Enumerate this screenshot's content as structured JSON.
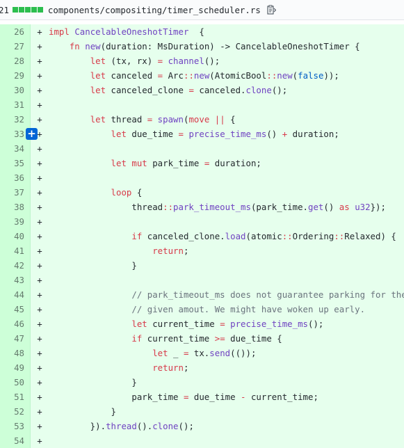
{
  "file": {
    "changes_count": "21",
    "path": "components/compositing/timer_scheduler.rs",
    "copy_icon": "clipboard-icon",
    "diffstat_color": "#2cbe4e"
  },
  "lines": [
    {
      "num": "26",
      "marker": "+",
      "code": [
        [
          "k",
          "impl "
        ],
        [
          "t",
          "CancelableOneshotTimer"
        ],
        [
          "",
          "  {"
        ]
      ]
    },
    {
      "num": "27",
      "marker": "+",
      "code": [
        [
          "",
          "    "
        ],
        [
          "k",
          "fn "
        ],
        [
          "f",
          "new"
        ],
        [
          "",
          "(duration: MsDuration) -> CancelableOneshotTimer {"
        ]
      ]
    },
    {
      "num": "28",
      "marker": "+",
      "code": [
        [
          "",
          "        "
        ],
        [
          "k",
          "let "
        ],
        [
          "",
          "(tx, rx) "
        ],
        [
          "k",
          "= "
        ],
        [
          "f",
          "channel"
        ],
        [
          "",
          "();"
        ]
      ]
    },
    {
      "num": "29",
      "marker": "+",
      "code": [
        [
          "",
          "        "
        ],
        [
          "k",
          "let "
        ],
        [
          "",
          "canceled "
        ],
        [
          "k",
          "= "
        ],
        [
          "",
          "Arc"
        ],
        [
          "k",
          "::"
        ],
        [
          "f",
          "new"
        ],
        [
          "",
          "(AtomicBool"
        ],
        [
          "k",
          "::"
        ],
        [
          "f",
          "new"
        ],
        [
          "",
          "("
        ],
        [
          "o",
          "false"
        ],
        [
          "",
          "));"
        ]
      ]
    },
    {
      "num": "30",
      "marker": "+",
      "code": [
        [
          "",
          "        "
        ],
        [
          "k",
          "let "
        ],
        [
          "",
          "canceled_clone "
        ],
        [
          "k",
          "= "
        ],
        [
          "",
          "canceled."
        ],
        [
          "f",
          "clone"
        ],
        [
          "",
          "();"
        ]
      ]
    },
    {
      "num": "31",
      "marker": "+",
      "code": []
    },
    {
      "num": "32",
      "marker": "+",
      "code": [
        [
          "",
          "        "
        ],
        [
          "k",
          "let "
        ],
        [
          "",
          "thread "
        ],
        [
          "k",
          "= "
        ],
        [
          "f",
          "spawn"
        ],
        [
          "",
          "("
        ],
        [
          "k",
          "move "
        ],
        [
          "k",
          "|| "
        ],
        [
          "",
          "{"
        ]
      ]
    },
    {
      "num": "33",
      "marker": "+",
      "comment": true,
      "code": [
        [
          "",
          "            "
        ],
        [
          "k",
          "let "
        ],
        [
          "",
          "due_time "
        ],
        [
          "k",
          "= "
        ],
        [
          "f",
          "precise_time_ms"
        ],
        [
          "",
          "() "
        ],
        [
          "k",
          "+ "
        ],
        [
          "",
          "duration;"
        ]
      ]
    },
    {
      "num": "34",
      "marker": "+",
      "code": []
    },
    {
      "num": "35",
      "marker": "+",
      "code": [
        [
          "",
          "            "
        ],
        [
          "k",
          "let "
        ],
        [
          "k",
          "mut "
        ],
        [
          "",
          "park_time "
        ],
        [
          "k",
          "= "
        ],
        [
          "",
          "duration;"
        ]
      ]
    },
    {
      "num": "36",
      "marker": "+",
      "code": []
    },
    {
      "num": "37",
      "marker": "+",
      "code": [
        [
          "",
          "            "
        ],
        [
          "k",
          "loop "
        ],
        [
          "",
          "{"
        ]
      ]
    },
    {
      "num": "38",
      "marker": "+",
      "code": [
        [
          "",
          "                thread"
        ],
        [
          "k",
          "::"
        ],
        [
          "f",
          "park_timeout_ms"
        ],
        [
          "",
          "(park_time."
        ],
        [
          "f",
          "get"
        ],
        [
          "",
          "() "
        ],
        [
          "k",
          "as "
        ],
        [
          "t",
          "u32"
        ],
        [
          "",
          "});"
        ]
      ]
    },
    {
      "num": "39",
      "marker": "+",
      "code": []
    },
    {
      "num": "40",
      "marker": "+",
      "code": [
        [
          "",
          "                "
        ],
        [
          "k",
          "if "
        ],
        [
          "",
          "canceled_clone."
        ],
        [
          "f",
          "load"
        ],
        [
          "",
          "(atomic"
        ],
        [
          "k",
          "::"
        ],
        [
          "",
          "Ordering"
        ],
        [
          "k",
          "::"
        ],
        [
          "",
          "Relaxed) {"
        ]
      ]
    },
    {
      "num": "41",
      "marker": "+",
      "code": [
        [
          "",
          "                    "
        ],
        [
          "k",
          "return"
        ],
        [
          "",
          ";"
        ]
      ]
    },
    {
      "num": "42",
      "marker": "+",
      "code": [
        [
          "",
          "                }"
        ]
      ]
    },
    {
      "num": "43",
      "marker": "+",
      "code": []
    },
    {
      "num": "44",
      "marker": "+",
      "code": [
        [
          "",
          "                "
        ],
        [
          "c",
          "// park_timeout_ms does not guarantee parking for the"
        ]
      ]
    },
    {
      "num": "45",
      "marker": "+",
      "code": [
        [
          "",
          "                "
        ],
        [
          "c",
          "// given amout. We might have woken up early."
        ]
      ]
    },
    {
      "num": "46",
      "marker": "+",
      "code": [
        [
          "",
          "                "
        ],
        [
          "k",
          "let "
        ],
        [
          "",
          "current_time "
        ],
        [
          "k",
          "= "
        ],
        [
          "f",
          "precise_time_ms"
        ],
        [
          "",
          "();"
        ]
      ]
    },
    {
      "num": "47",
      "marker": "+",
      "code": [
        [
          "",
          "                "
        ],
        [
          "k",
          "if "
        ],
        [
          "",
          "current_time "
        ],
        [
          "k",
          ">= "
        ],
        [
          "",
          "due_time {"
        ]
      ]
    },
    {
      "num": "48",
      "marker": "+",
      "code": [
        [
          "",
          "                    "
        ],
        [
          "k",
          "let "
        ],
        [
          "",
          "_ "
        ],
        [
          "k",
          "= "
        ],
        [
          "",
          "tx."
        ],
        [
          "f",
          "send"
        ],
        [
          "",
          "(());"
        ]
      ]
    },
    {
      "num": "49",
      "marker": "+",
      "code": [
        [
          "",
          "                    "
        ],
        [
          "k",
          "return"
        ],
        [
          "",
          ";"
        ]
      ]
    },
    {
      "num": "50",
      "marker": "+",
      "code": [
        [
          "",
          "                }"
        ]
      ]
    },
    {
      "num": "51",
      "marker": "+",
      "code": [
        [
          "",
          "                park_time "
        ],
        [
          "k",
          "= "
        ],
        [
          "",
          "due_time "
        ],
        [
          "k",
          "- "
        ],
        [
          "",
          "current_time;"
        ]
      ]
    },
    {
      "num": "52",
      "marker": "+",
      "code": [
        [
          "",
          "            }"
        ]
      ]
    },
    {
      "num": "53",
      "marker": "+",
      "code": [
        [
          "",
          "        })."
        ],
        [
          "f",
          "thread"
        ],
        [
          "",
          "()."
        ],
        [
          "f",
          "clone"
        ],
        [
          "",
          "();"
        ]
      ]
    },
    {
      "num": "54",
      "marker": "+",
      "code": []
    }
  ]
}
